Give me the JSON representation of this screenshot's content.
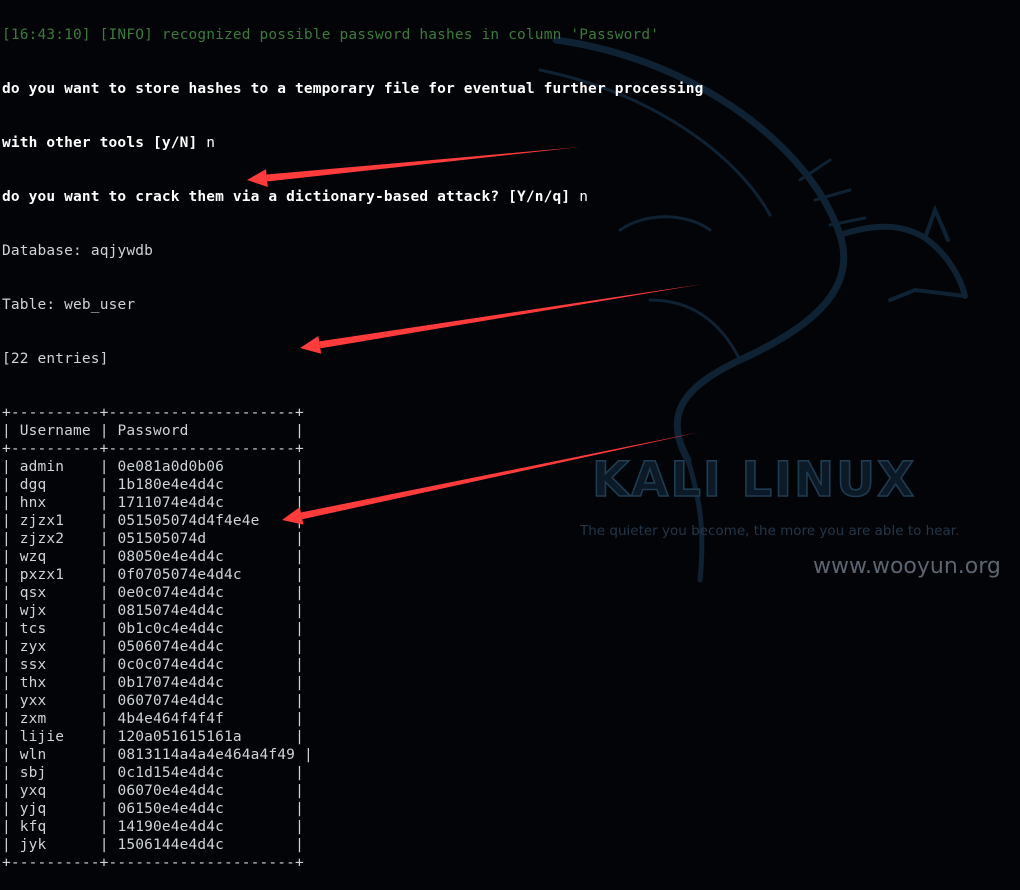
{
  "log": {
    "info_prefix": "[16:43:10] [INFO]",
    "info_text": "recognized possible password hashes in column 'Password'"
  },
  "prompts": {
    "store_question_line1": "do you want to store hashes to a temporary file for eventual further processing",
    "store_question_line2": "with other tools [y/N]",
    "store_answer": "n",
    "crack_question": "do you want to crack them via a dictionary-based attack? [Y/n/q]",
    "crack_answer": "n"
  },
  "meta": {
    "database_label": "Database:",
    "database_value": "aqjywdb",
    "table_label": "Table:",
    "table_value": "web_user",
    "entries": "[22 entries]"
  },
  "table": {
    "border": "+----------+---------------------+",
    "headers": [
      "Username",
      "Password"
    ],
    "rows": [
      [
        "admin",
        "0e081a0d0b06"
      ],
      [
        "dgq",
        "1b180e4e4d4c"
      ],
      [
        "hnx",
        "1711074e4d4c"
      ],
      [
        "zjzx1",
        "051505074d4f4e4e"
      ],
      [
        "zjzx2",
        "051505074d"
      ],
      [
        "wzq",
        "08050e4e4d4c"
      ],
      [
        "pxzx1",
        "0f0705074e4d4c"
      ],
      [
        "qsx",
        "0e0c074e4d4c"
      ],
      [
        "wjx",
        "0815074e4d4c"
      ],
      [
        "tcs",
        "0b1c0c4e4d4c"
      ],
      [
        "zyx",
        "0506074e4d4c"
      ],
      [
        "ssx",
        "0c0c074e4d4c"
      ],
      [
        "thx",
        "0b17074e4d4c"
      ],
      [
        "yxx",
        "0607074e4d4c"
      ],
      [
        "zxm",
        "4b4e464f4f4f"
      ],
      [
        "lijie",
        "120a051615161a"
      ],
      [
        "wln",
        "0813114a4a4e464a4f49"
      ],
      [
        "sbj",
        "0c1d154e4d4c"
      ],
      [
        "yxq",
        "06070e4e4d4c"
      ],
      [
        "yjq",
        "06150e4e4d4c"
      ],
      [
        "kfq",
        "14190e4e4d4c"
      ],
      [
        "jyk",
        "1506144e4d4c"
      ]
    ]
  },
  "wallpaper": {
    "logo_text": "KALI LINUX",
    "tagline": "The quieter you become, the more you are able to hear.",
    "watermark": "www.wooyun.org"
  },
  "annotations": {
    "arrow_color": "#ff3b3b",
    "arrow_count": 3
  }
}
